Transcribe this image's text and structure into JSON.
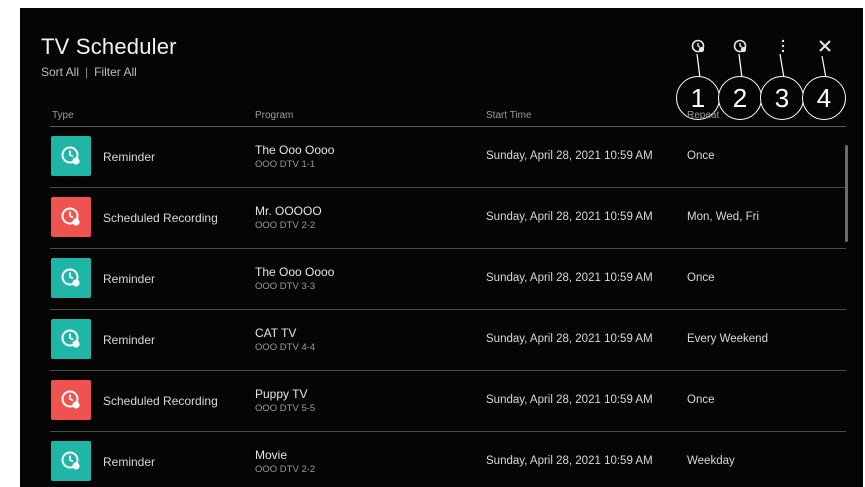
{
  "header": {
    "title": "TV Scheduler",
    "sort_label": "Sort All",
    "separator": "|",
    "filter_label": "Filter All"
  },
  "toolbar": {
    "icons": [
      "add-reminder-icon",
      "add-recording-icon",
      "more-options-icon",
      "close-icon"
    ],
    "callouts": [
      "1",
      "2",
      "3",
      "4"
    ]
  },
  "columns": {
    "type": "Type",
    "program": "Program",
    "start_time": "Start Time",
    "repeat": "Repeat"
  },
  "rows": [
    {
      "type": "Reminder",
      "program": "The Ooo Oooo",
      "channel": "OOO DTV 1-1",
      "start": "Sunday, April 28, 2021 10:59 AM",
      "repeat": "Once",
      "kind": "reminder"
    },
    {
      "type": "Scheduled Recording",
      "program": "Mr. OOOOO",
      "channel": "OOO DTV 2-2",
      "start": "Sunday, April 28, 2021 10:59 AM",
      "repeat": "Mon, Wed, Fri",
      "kind": "recording"
    },
    {
      "type": "Reminder",
      "program": "The Ooo Oooo",
      "channel": "OOO DTV 3-3",
      "start": "Sunday, April 28, 2021 10:59 AM",
      "repeat": "Once",
      "kind": "reminder"
    },
    {
      "type": "Reminder",
      "program": "CAT TV",
      "channel": "OOO DTV 4-4",
      "start": "Sunday, April 28, 2021 10:59 AM",
      "repeat": "Every Weekend",
      "kind": "reminder"
    },
    {
      "type": "Scheduled Recording",
      "program": "Puppy TV",
      "channel": "OOO DTV 5-5",
      "start": "Sunday, April 28, 2021 10:59 AM",
      "repeat": "Once",
      "kind": "recording"
    },
    {
      "type": "Reminder",
      "program": "Movie",
      "channel": "OOO DTV 2-2",
      "start": "Sunday, April 28, 2021 10:59 AM",
      "repeat": "Weekday",
      "kind": "reminder"
    }
  ],
  "colors": {
    "reminder": "#1fb5a7",
    "recording": "#f0524f",
    "background": "#050505"
  }
}
